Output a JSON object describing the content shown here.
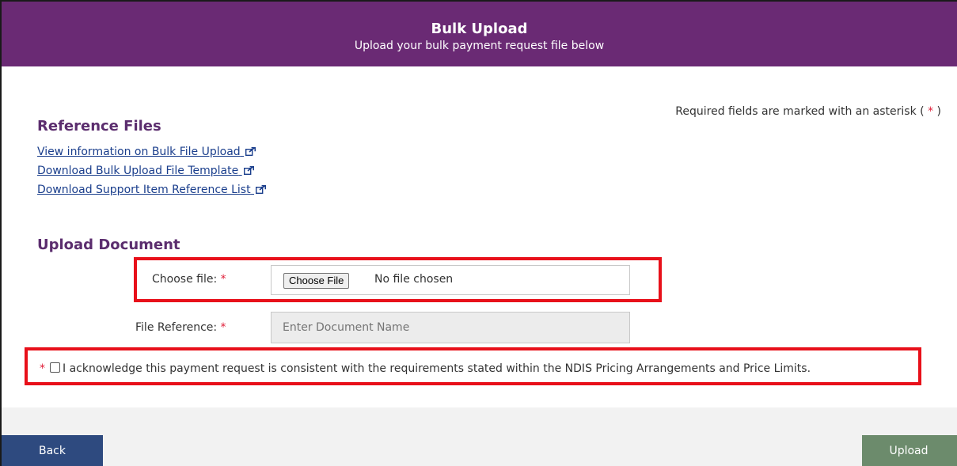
{
  "header": {
    "title": "Bulk Upload",
    "subtitle": "Upload your bulk payment request file below"
  },
  "required_note": {
    "prefix": "Required fields are marked with an asterisk (",
    "star": "*",
    "suffix": ")"
  },
  "reference_files": {
    "title": "Reference Files",
    "links": [
      "View information on Bulk File Upload",
      "Download Bulk Upload File Template",
      "Download Support Item Reference List"
    ]
  },
  "upload_document": {
    "title": "Upload Document",
    "choose_file_label": "Choose file:",
    "choose_file_button": "Choose File",
    "no_file_text": "No file chosen",
    "file_reference_label": "File Reference:",
    "file_reference_placeholder": "Enter Document Name",
    "required_star": "*"
  },
  "acknowledgement": {
    "star": "*",
    "text": "I acknowledge this payment request is consistent with the requirements stated within the NDIS Pricing Arrangements and Price Limits.",
    "checked": false
  },
  "footer": {
    "back_label": "Back",
    "upload_label": "Upload"
  },
  "colors": {
    "header_bg": "#6a2a74",
    "section_title": "#5b2d6e",
    "link": "#1a3e8c",
    "required_star": "#e0203a",
    "highlight_box": "#e8101a",
    "back_button": "#2e4a7f",
    "upload_button": "#6c8b6c"
  },
  "icons": {
    "external_link": "external-link-icon",
    "checkbox": "checkbox-icon"
  }
}
